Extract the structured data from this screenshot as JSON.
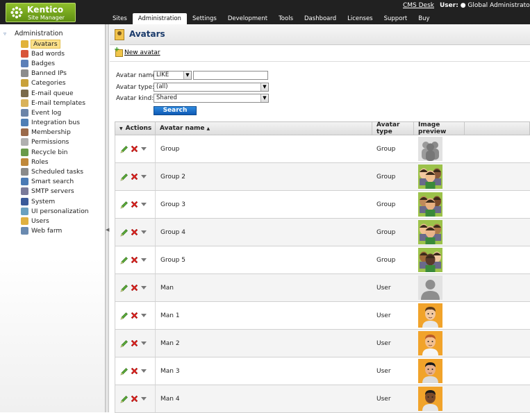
{
  "logo": {
    "line1": "Kentico",
    "line2": "Site Manager"
  },
  "topnav": [
    "Sites",
    "Administration",
    "Settings",
    "Development",
    "Tools",
    "Dashboard",
    "Licenses",
    "Support",
    "Buy"
  ],
  "topnav_active": "Administration",
  "header_links": {
    "cms_desk": "CMS Desk",
    "user_label": "User:",
    "user_name": "Global Administrator"
  },
  "tree": {
    "root": "Administration",
    "items": [
      "Avatars",
      "Bad words",
      "Badges",
      "Banned IPs",
      "Categories",
      "E-mail queue",
      "E-mail templates",
      "Event log",
      "Integration bus",
      "Membership",
      "Permissions",
      "Recycle bin",
      "Roles",
      "Scheduled tasks",
      "Smart search",
      "SMTP servers",
      "System",
      "UI personalization",
      "Users",
      "Web farm"
    ],
    "selected": "Avatars"
  },
  "page": {
    "title": "Avatars",
    "new_link": "New avatar"
  },
  "filter": {
    "name_label": "Avatar name:",
    "name_operator": "LIKE",
    "name_value": "",
    "type_label": "Avatar type:",
    "type_value": "(all)",
    "kind_label": "Avatar kind:",
    "kind_value": "Shared",
    "search_label": "Search"
  },
  "grid": {
    "headers": {
      "actions": "Actions",
      "name": "Avatar name",
      "type": "Avatar type",
      "preview": "Image preview"
    },
    "rows": [
      {
        "name": "Group",
        "type": "Group"
      },
      {
        "name": "Group 2",
        "type": "Group"
      },
      {
        "name": "Group 3",
        "type": "Group"
      },
      {
        "name": "Group 4",
        "type": "Group"
      },
      {
        "name": "Group 5",
        "type": "Group"
      },
      {
        "name": "Man",
        "type": "User"
      },
      {
        "name": "Man 1",
        "type": "User"
      },
      {
        "name": "Man 2",
        "type": "User"
      },
      {
        "name": "Man 3",
        "type": "User"
      },
      {
        "name": "Man 4",
        "type": "User"
      }
    ]
  },
  "colors": {
    "topbar": "#212121",
    "logo_green": "#7aa81f",
    "selected_item": "#fbe08a",
    "search_button": "#1f72cc"
  }
}
